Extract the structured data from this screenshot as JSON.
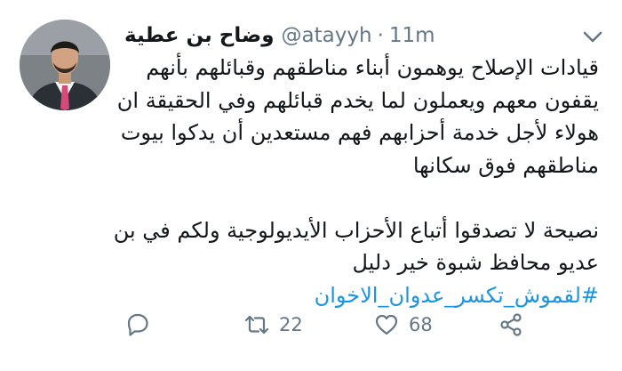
{
  "tweet": {
    "author_name": "وضاح بن عطية",
    "handle": "@atayyh",
    "separator": "·",
    "time": "11m",
    "lines": [
      "قيادات الإصلاح يوهمون أبناء مناطقهم وقبائلهم بأنهم",
      "يقفون معهم ويعملون لما يخدم قبائلهم وفي الحقيقة ان",
      "هولاء لأجل خدمة أحزابهم فهم مستعدين أن يدكوا بيوت",
      "مناطقهم فوق سكانها",
      "نصيحة لا تصدقوا أتباع الأحزاب الأيديولوجية ولكم في بن",
      "عديو محافظ شبوة خير دليل"
    ],
    "hashtag": "#لقموش_تكسر_عدوان_الاخوان"
  },
  "actions": {
    "reply_icon": "reply-icon",
    "retweet_icon": "retweet-icon",
    "retweet_count": "22",
    "like_icon": "heart-icon",
    "like_count": "68",
    "share_icon": "share-icon"
  },
  "colors": {
    "text": "#14171a",
    "muted": "#657786",
    "hashtag": "#1b95e0"
  }
}
